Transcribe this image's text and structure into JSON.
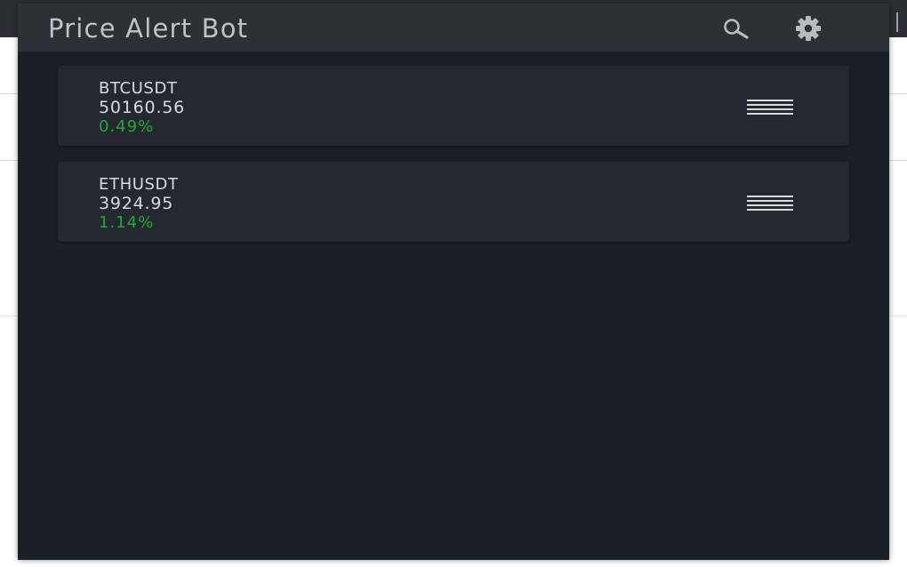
{
  "app": {
    "title": "Price Alert Bot"
  },
  "header": {
    "search_icon": "search-icon",
    "settings_icon": "gear-icon"
  },
  "alerts": [
    {
      "symbol": "BTCUSDT",
      "price": "50160.56",
      "change": "0.49%",
      "menu_icon": "hamburger-icon"
    },
    {
      "symbol": "ETHUSDT",
      "price": "3924.95",
      "change": "1.14%",
      "menu_icon": "hamburger-icon"
    }
  ],
  "colors": {
    "popup_bg": "#1b1f26",
    "header_bg": "#2d3136",
    "card_bg": "#242830",
    "positive_change": "#1faa2c",
    "text": "#d7d9dc"
  }
}
